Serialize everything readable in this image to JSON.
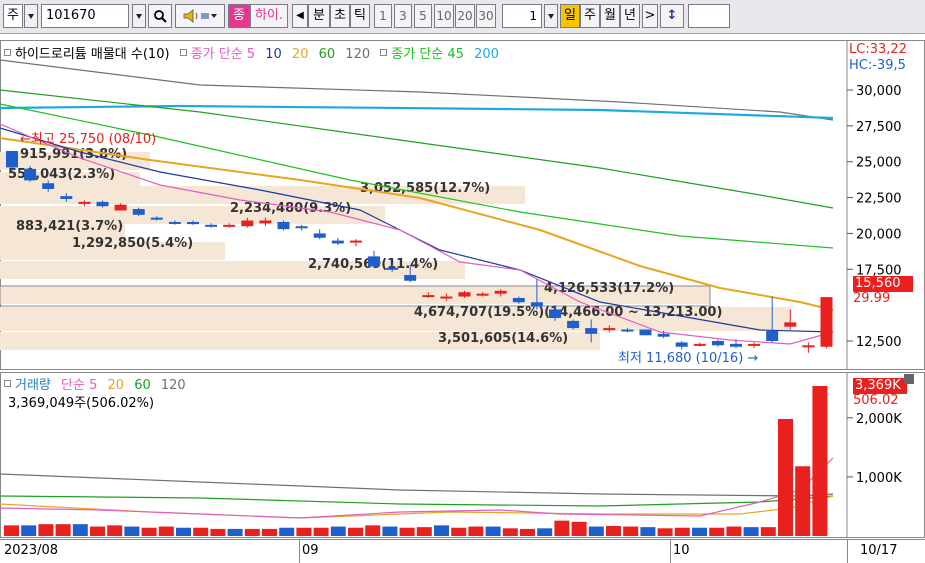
{
  "toolbar": {
    "period_type": "주",
    "stock_code": "101670",
    "tab_selected": "종",
    "tab_stock_name": "하이.",
    "time_unit": "분",
    "time_units_extra": [
      "초",
      "틱"
    ],
    "intervals": [
      "1",
      "3",
      "5",
      "10",
      "20",
      "30"
    ],
    "interval_value": "1",
    "period_day": "일",
    "period_week": "주",
    "period_month": "월",
    "period_year": "년",
    "next_label": ">",
    "updown_label": "↕"
  },
  "price_legend": {
    "title": "하이드로리튬 매물대 수(10)",
    "ma_label_1": "종가 단순 5",
    "ma_10": "10",
    "ma_20": "20",
    "ma_60": "60",
    "ma_120": "120",
    "ma_label_2": "종가 단순 45",
    "ma_200": "200"
  },
  "price_axis": {
    "lc": "LC:33,22",
    "hc": "HC:-39,5",
    "ticks": [
      "30,000",
      "27,500",
      "25,000",
      "22,500",
      "20,000",
      "17,500",
      "12,500"
    ],
    "current_price": "15,560",
    "current_change": "29.99"
  },
  "volume_profile": [
    {
      "label": "915,991(3.8%)"
    },
    {
      "label": "551,043(2.3%)"
    },
    {
      "label": "3,052,585(12.7%)"
    },
    {
      "label": "2,234,480(9.3%)"
    },
    {
      "label": "883,421(3.7%)"
    },
    {
      "label": "1,292,850(5.4%)"
    },
    {
      "label": "2,740,569(11.4%)"
    },
    {
      "label": "4,126,533(17.2%)"
    },
    {
      "label": "4,674,707(19.5%)(14,466.00 ~ 13,213.00)"
    },
    {
      "label": "3,501,605(14.6%)"
    }
  ],
  "annotations": {
    "high": "최고 25,750 (08/10)",
    "low": "최저 11,680 (10/16)"
  },
  "volume_legend": {
    "title": "거래량",
    "ma_label": "단순 5",
    "ma_20": "20",
    "ma_60": "60",
    "ma_120": "120",
    "summary": "3,369,049주(506.02%)"
  },
  "volume_axis": {
    "current_vol": "3,369K",
    "current_pct": "506.02",
    "ticks": [
      "2,000K",
      "1,000K"
    ]
  },
  "date_axis": {
    "labels": [
      "2023/08",
      "09",
      "10"
    ],
    "current_date": "10/17"
  },
  "colors": {
    "up": "#e8201e",
    "down": "#1f5fcc",
    "ma5": "#e060c0",
    "ma10": "#1a3aa0",
    "ma20": "#e8a520",
    "ma60": "#20a020",
    "ma120": "#707070",
    "ma45": "#20c020",
    "ma200": "#20a8e0",
    "profile": "#f5e6d6"
  },
  "chart_data": {
    "type": "candlestick",
    "ohlc": [
      [
        25750,
        25750,
        24300,
        24600
      ],
      [
        24500,
        24700,
        23600,
        23700
      ],
      [
        23500,
        23700,
        22900,
        23100
      ],
      [
        22600,
        22800,
        22200,
        22400
      ],
      [
        22100,
        22300,
        21900,
        22200
      ],
      [
        22200,
        22300,
        21800,
        21900
      ],
      [
        21600,
        22100,
        21700,
        22000
      ],
      [
        21700,
        21800,
        21200,
        21300
      ],
      [
        21100,
        21200,
        20900,
        21000
      ],
      [
        20800,
        20900,
        20600,
        20700
      ],
      [
        20800,
        20900,
        20600,
        20650
      ],
      [
        20600,
        20700,
        20400,
        20500
      ],
      [
        20500,
        20700,
        20400,
        20600
      ],
      [
        20500,
        21100,
        20400,
        20900
      ],
      [
        20700,
        21100,
        20500,
        20900
      ],
      [
        20800,
        20900,
        20200,
        20300
      ],
      [
        20500,
        20600,
        20200,
        20400
      ],
      [
        20000,
        20300,
        19600,
        19700
      ],
      [
        19500,
        19700,
        19200,
        19300
      ],
      [
        19400,
        19600,
        19100,
        19500
      ],
      [
        18400,
        18800,
        17600,
        17700
      ],
      [
        17600,
        17900,
        17300,
        17500
      ],
      [
        17100,
        17800,
        16600,
        16700
      ],
      [
        15700,
        15900,
        15500,
        15700
      ],
      [
        15500,
        15800,
        15300,
        15600
      ],
      [
        15600,
        16000,
        15500,
        15900
      ],
      [
        15700,
        15900,
        15600,
        15800
      ],
      [
        15800,
        16100,
        15600,
        16000
      ],
      [
        15500,
        15600,
        15100,
        15200
      ],
      [
        15200,
        16800,
        14700,
        14900
      ],
      [
        14700,
        15000,
        13900,
        14100
      ],
      [
        13900,
        14000,
        13300,
        13400
      ],
      [
        13400,
        14000,
        12400,
        13000
      ],
      [
        13300,
        13600,
        13100,
        13400
      ],
      [
        13300,
        13400,
        13100,
        13200
      ],
      [
        13300,
        13300,
        12900,
        12900
      ],
      [
        13000,
        13200,
        12700,
        12800
      ],
      [
        12400,
        12500,
        11900,
        12100
      ],
      [
        12200,
        12400,
        12100,
        12300
      ],
      [
        12500,
        12600,
        12100,
        12200
      ],
      [
        12300,
        12600,
        12000,
        12100
      ],
      [
        12200,
        12400,
        12000,
        12300
      ],
      [
        13200,
        15600,
        12400,
        12500
      ],
      [
        13500,
        14700,
        13300,
        13800
      ],
      [
        12100,
        12400,
        11680,
        12200
      ],
      [
        12100,
        15560,
        12000,
        15560
      ]
    ],
    "volume_k": [
      180,
      180,
      200,
      200,
      200,
      160,
      180,
      160,
      140,
      160,
      140,
      140,
      120,
      120,
      120,
      120,
      140,
      140,
      140,
      160,
      140,
      180,
      160,
      140,
      150,
      180,
      140,
      160,
      160,
      130,
      120,
      130,
      260,
      240,
      160,
      170,
      160,
      150,
      130,
      140,
      140,
      140,
      160,
      150,
      150,
      1980,
      1180,
      3369
    ]
  }
}
